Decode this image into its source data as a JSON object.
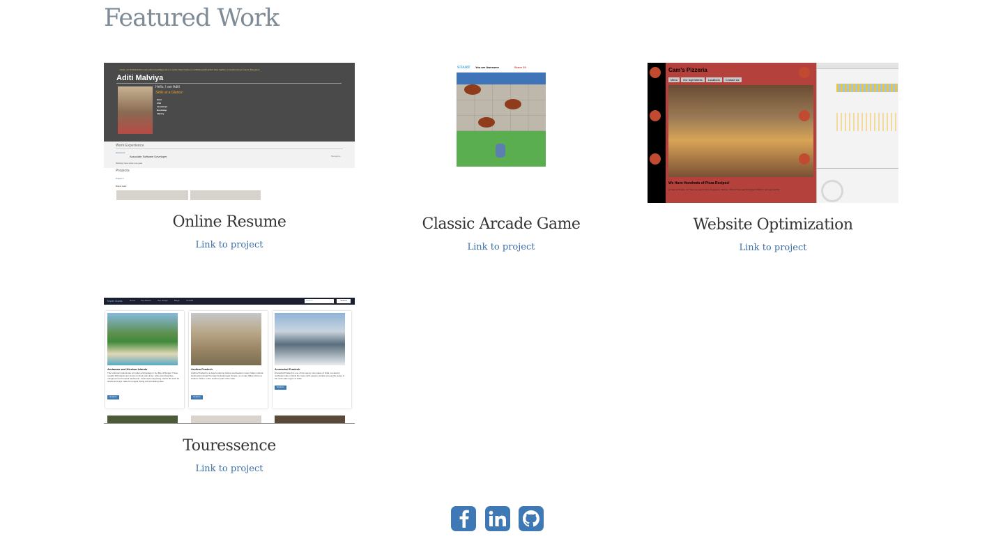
{
  "section": {
    "title": "Featured Work"
  },
  "projects": [
    {
      "title": "Online Resume",
      "link_label": "Link to project"
    },
    {
      "title": "Classic Arcade Game",
      "link_label": "Link to project"
    },
    {
      "title": "Website Optimization",
      "link_label": "Link to project"
    },
    {
      "title": "Touressence",
      "link_label": "Link to project"
    }
  ],
  "thumbs": {
    "resume": {
      "header_line": "mobile +91-8181421600   email aditimalviya8@gmail.com   twitter https://twitter.com/iMalviyaAditi   github https://github.com/aditimalviya   location Bangalore",
      "name": "Aditi Malviya",
      "greeting": "Hello, I am Aditi",
      "skills_heading": "Skills at a Glance:",
      "skills": [
        "Html",
        "CSS",
        "JavaScript",
        "Bootstrap",
        "JQuery"
      ],
      "work_heading": "Work Experience",
      "company": "Accenture",
      "role": "Associate Software Developer",
      "location": "Bangalore",
      "work_desc": "Working here since one year",
      "projects_heading": "Projects",
      "project_name": "Project 1",
      "project_sub": "Brand Card"
    },
    "arcade": {
      "start": "START",
      "status": "You are Awesome",
      "score": "Score 10"
    },
    "pizza": {
      "title": "Cam's Pizzeria",
      "nav": [
        "Menu",
        "Our Ingredients",
        "Locations",
        "Contact Us"
      ],
      "headline": "We Have Hundreds of Pizza Recipes!",
      "body": "At Cam's Pizzeria, we have you well spoken. Pepperoni, Shrimp, Cheese? No way! Sausage? Chicken, let's get creative."
    },
    "tour": {
      "brand": "Travel Goals",
      "nav": [
        "Home",
        "Top Places",
        "Top Things",
        "Blogs",
        "Contact"
      ],
      "search_placeholder": "Search",
      "submit": "Submit",
      "cards": [
        {
          "title": "Andaman and Nicobar Islands",
          "text": "The Andaman Islands are an Indian archipelago in the Bay of Bengal. These roughly 300 islands are known for their palm-lined, white-sand beaches, mangroves and tropical rainforests. Coral reefs supporting marine life such as sharks and rays make for popular diving and snorkeling sites.",
          "button": "Explore"
        },
        {
          "title": "Andhra Pradesh",
          "text": "Andhra Pradesh is a state bordering India's southeastern coast. Major cultural landmarks include Tirumala Venkateswara Temple, an ornate hilltop shrine to Hindu's Vishnu, in the southern part of the state.",
          "button": "Explore"
        },
        {
          "title": "Arunachal Pradesh",
          "text": "Arunachal Pradesh is one of the twenty nine states of India. Located in northeast India, it holds the most north-eastern position among the states in the north-east region of India.",
          "button": "Explore"
        }
      ]
    }
  },
  "social": [
    {
      "icon": "facebook-icon",
      "glyph": "f"
    },
    {
      "icon": "linkedin-icon",
      "glyph": "in"
    },
    {
      "icon": "github-icon",
      "glyph": ""
    }
  ],
  "colors": {
    "title": "#7e8b96",
    "link": "#3b6ea5",
    "social": "#3f79b5"
  }
}
